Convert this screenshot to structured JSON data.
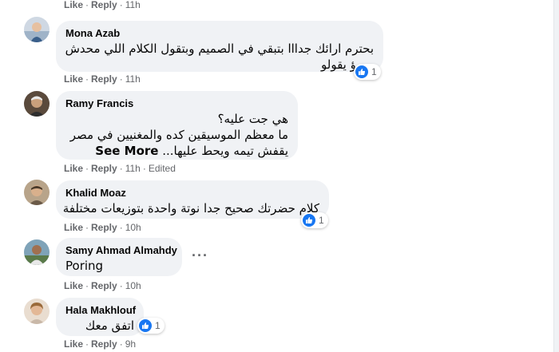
{
  "actions": {
    "like": "Like",
    "reply": "Reply",
    "dot": "·"
  },
  "colors": {
    "like_blue": "#1877f2",
    "bubble_bg": "#f0f2f5",
    "meta_gray": "#65676b"
  },
  "top_row": {
    "time": "11h"
  },
  "comments": [
    {
      "author": "Mona Azab",
      "lines": [
        "بحترم ارائك جدااا بتبقي في الصميم وبتقول الكلام اللي محدش",
        "يجرؤ يقولو"
      ],
      "reactions": {
        "icon": "like-icon",
        "count": "1"
      },
      "time": "11h"
    },
    {
      "author": "Ramy Francis",
      "lines": [
        "هي جت عليه؟",
        "ما معظم الموسيقين كده والمغنيين في مصر",
        "يقفش تيمه ويحط عليها..."
      ],
      "see_more": "See More",
      "time": "11h",
      "edited": "Edited"
    },
    {
      "author": "Khalid Moaz",
      "lines": [
        "كلام حضرتك صحيح جدا نوتة واحدة بتوزيعات مختلفة"
      ],
      "reactions": {
        "icon": "like-icon",
        "count": "1"
      },
      "time": "10h"
    },
    {
      "author": "Samy Ahmad Almahdy",
      "lines": [
        "Poring"
      ],
      "more_options": "···",
      "time": "10h"
    },
    {
      "author": "Hala Makhlouf",
      "lines": [
        "اتفق معك"
      ],
      "reactions": {
        "icon": "like-icon",
        "count": "1"
      },
      "time": "9h"
    }
  ]
}
